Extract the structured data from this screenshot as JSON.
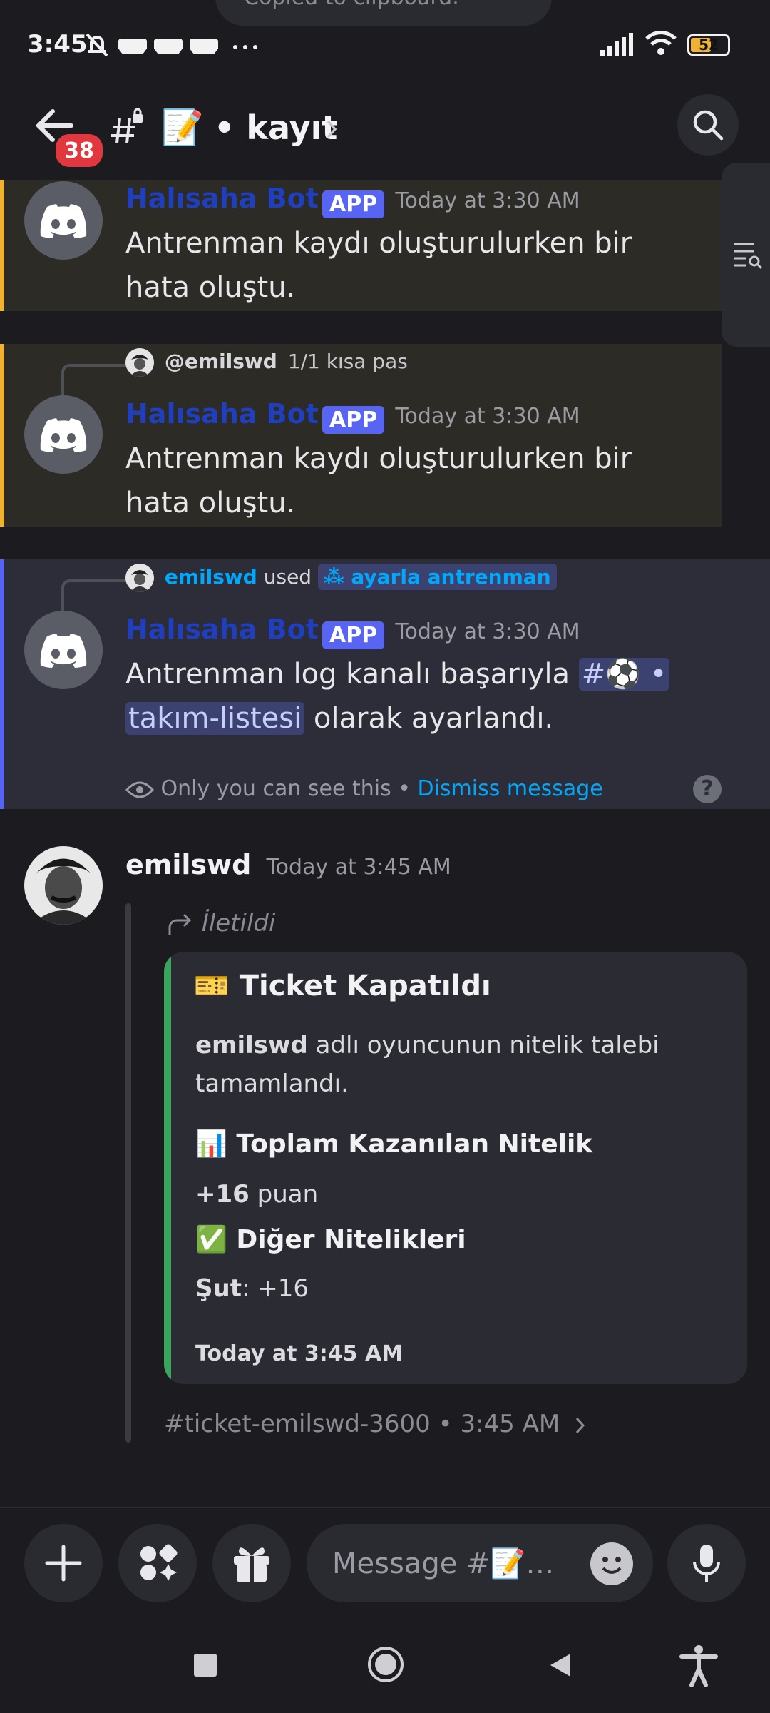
{
  "status_bar": {
    "time": "3:45",
    "battery": "52",
    "toast": "Copied to clipboard."
  },
  "header": {
    "unread_count": "38",
    "channel_emoji": "📝",
    "channel_name": "• kayıt"
  },
  "messages": [
    {
      "author": "Halısaha Bot",
      "tag": "APP",
      "time": "Today at 3:30 AM",
      "text": "Antrenman kaydı oluşturulurken bir hata oluştu."
    },
    {
      "reply_user": "@emilswd",
      "reply_text": "1/1 kısa pas",
      "author": "Halısaha Bot",
      "tag": "APP",
      "time": "Today at 3:30 AM",
      "text": "Antrenman kaydı oluşturulurken bir hata oluştu."
    },
    {
      "used_user": "emilswd",
      "used_word": "used",
      "command": "ayarla antrenman",
      "author": "Halısaha Bot",
      "tag": "APP",
      "time": "Today at 3:30 AM",
      "text_before": "Antrenman log kanalı başarıyla",
      "channel_mention_a": "#⚽ •",
      "channel_mention_b": "takım-listesi",
      "text_after": "olarak ayarlandı.",
      "ephemeral_note": "Only you can see this",
      "dismiss": "Dismiss message"
    }
  ],
  "forward": {
    "author": "emilswd",
    "time": "Today at 3:45 AM",
    "forwarded_label": "İletildi",
    "embed_title": "Ticket Kapatıldı",
    "embed_user": "emilswd",
    "embed_desc_rest": "adlı oyuncunun nitelik talebi tamamlandı.",
    "field1_title": "Toplam Kazanılan Nitelik",
    "field1_bold": "+16",
    "field1_rest": "puan",
    "field2_title": "Diğer Nitelikleri",
    "field2_bold": "Şut",
    "field2_rest": ": +16",
    "embed_footer": "Today at 3:45 AM",
    "source": "#ticket-emilswd-3600 • 3:45 AM"
  },
  "composer": {
    "placeholder": "Message #📝…"
  }
}
